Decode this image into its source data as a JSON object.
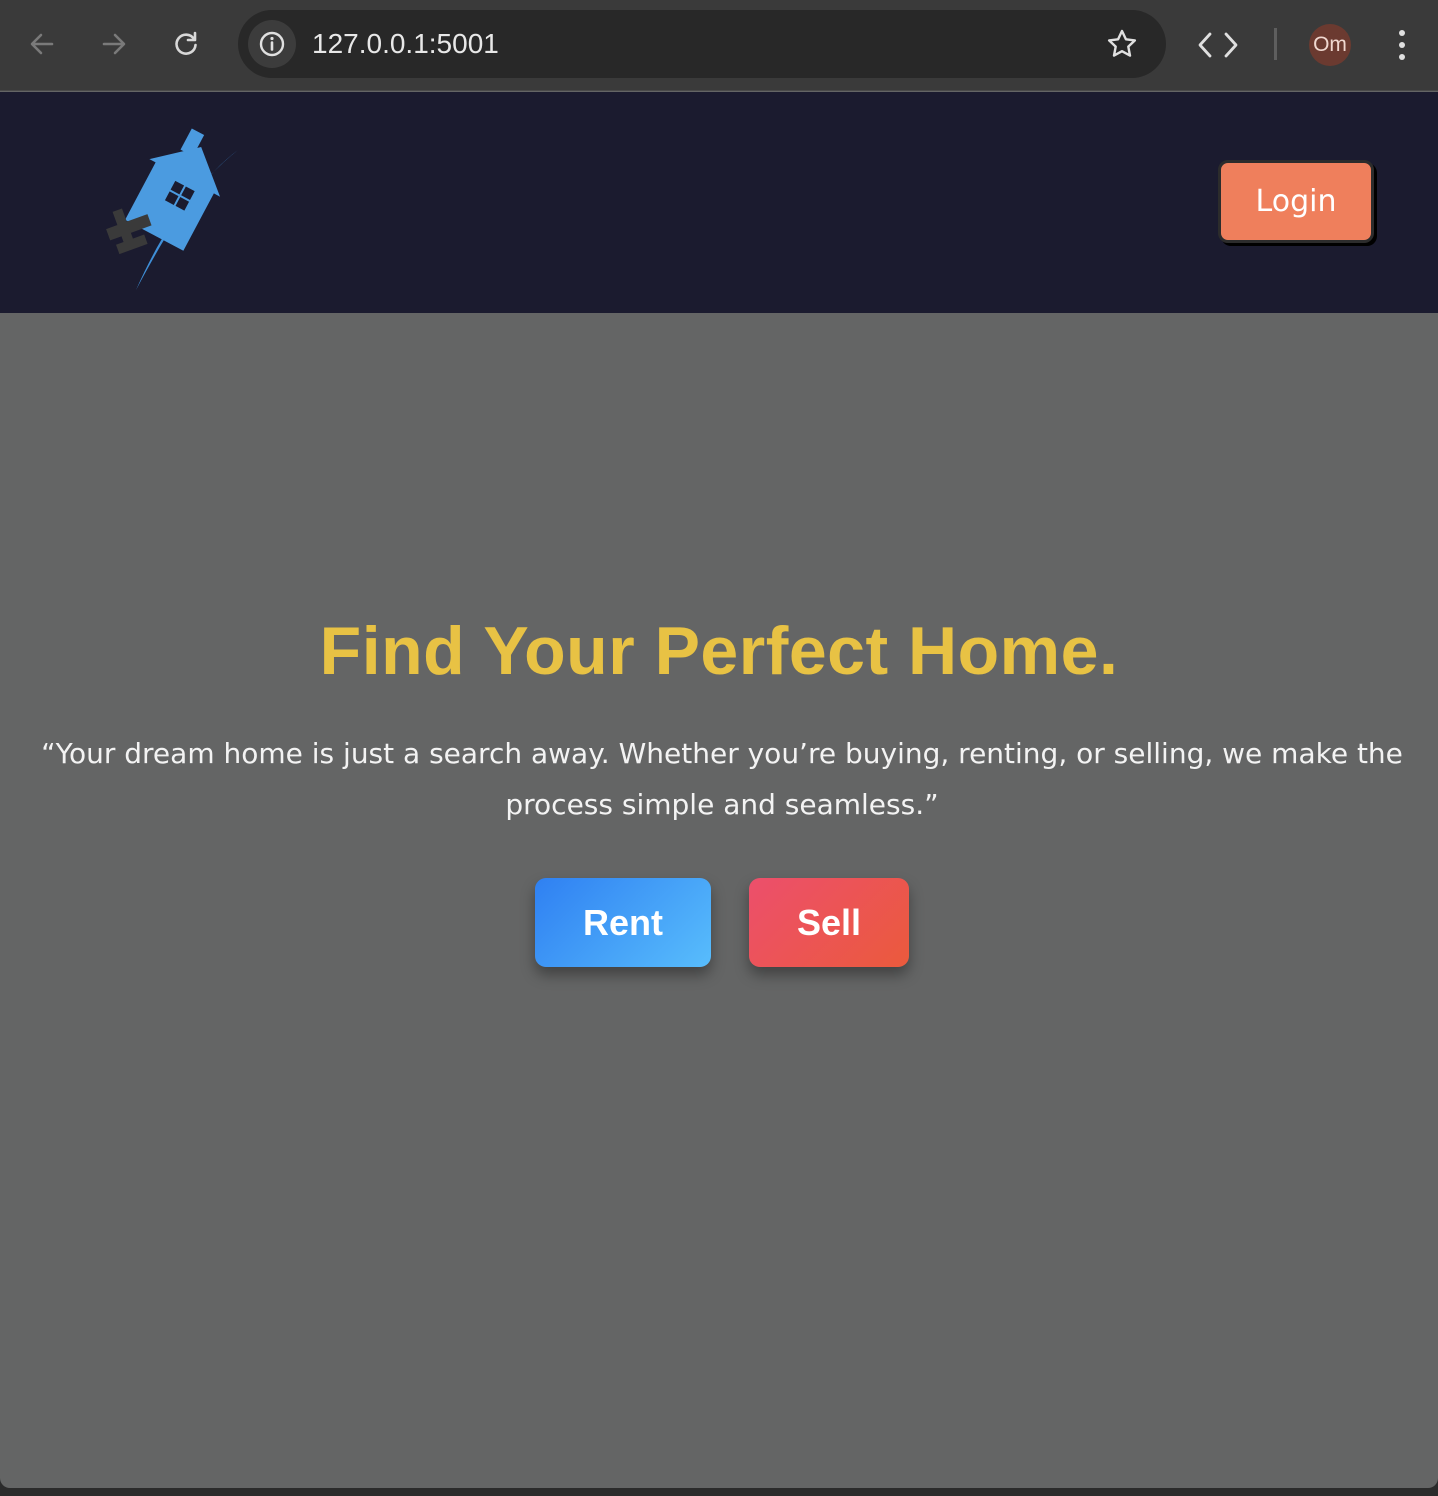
{
  "browser": {
    "url": "127.0.0.1:5001",
    "profile_initials": "Om",
    "icons": [
      "back-arrow-icon",
      "forward-arrow-icon",
      "reload-icon",
      "info-icon",
      "star-icon",
      "code-icon",
      "kebab-menu-icon"
    ]
  },
  "header": {
    "login_label": "Login",
    "logo_icon": "house-logo-icon"
  },
  "hero": {
    "title": "Find Your Perfect Home.",
    "subtitle": "“Your dream home is just a search away. Whether you’re buying, renting, or selling, we make the process simple and seamless.”",
    "rent_label": "Rent",
    "sell_label": "Sell"
  },
  "colors": {
    "page_background": "#646565",
    "header_background": "#1b1b2f",
    "title_color": "#e8c244",
    "login_button": "#ef7f5c",
    "rent_gradient": [
      "#2f80f2",
      "#58bdfc"
    ],
    "sell_gradient": [
      "#ec4f6c",
      "#eb5a3c"
    ]
  }
}
